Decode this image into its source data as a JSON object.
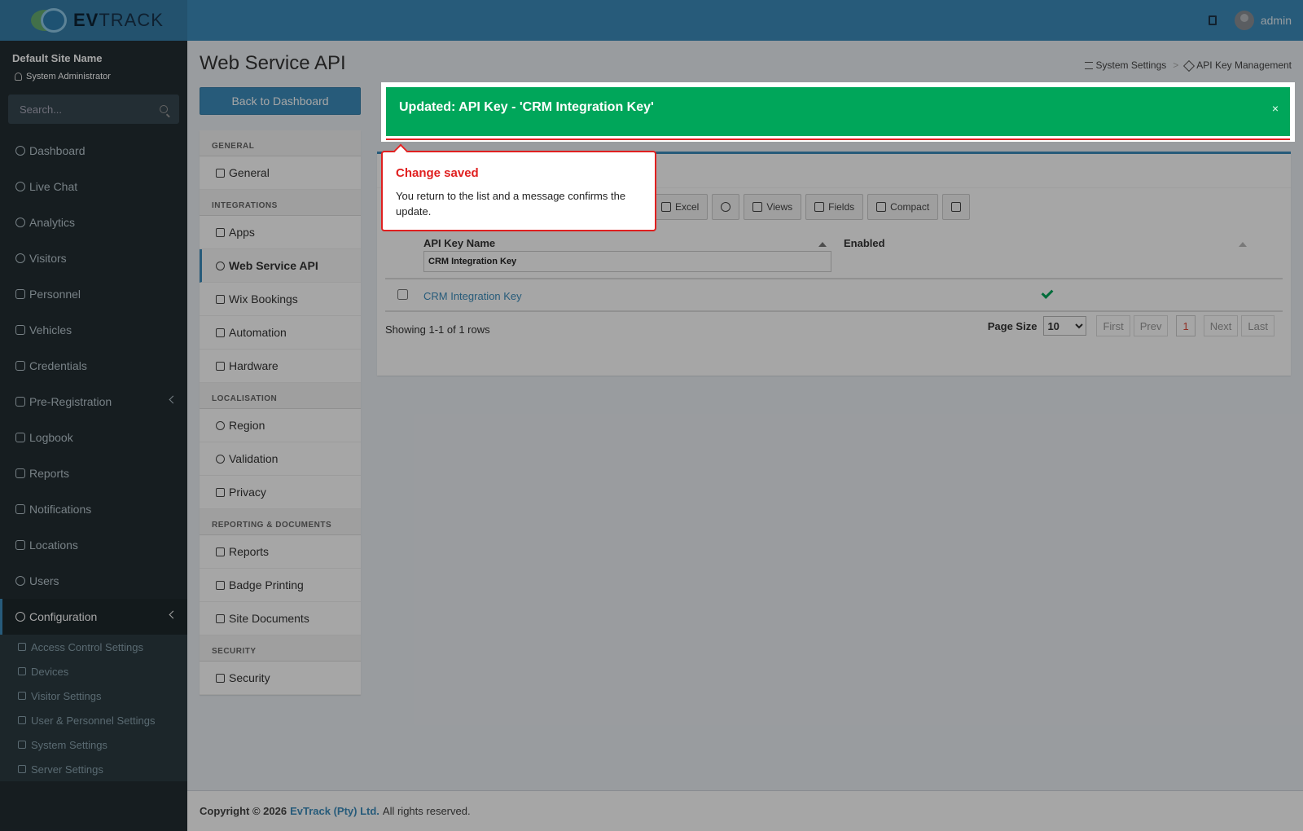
{
  "header": {
    "logo_left": "EV",
    "logo_right": "TRACK",
    "username": "admin"
  },
  "sidebar": {
    "site_name": "Default Site Name",
    "role": "System Administrator",
    "search_placeholder": "Search...",
    "items": [
      {
        "label": "Dashboard",
        "icon": "dashboard-icon"
      },
      {
        "label": "Live Chat",
        "icon": "headset-icon"
      },
      {
        "label": "Analytics",
        "icon": "analytics-icon"
      },
      {
        "label": "Visitors",
        "icon": "eye-icon"
      },
      {
        "label": "Personnel",
        "icon": "personnel-icon"
      },
      {
        "label": "Vehicles",
        "icon": "car-icon"
      },
      {
        "label": "Credentials",
        "icon": "id-card-icon"
      },
      {
        "label": "Pre-Registration",
        "icon": "arrows-icon"
      },
      {
        "label": "Logbook",
        "icon": "book-icon"
      },
      {
        "label": "Reports",
        "icon": "chart-icon"
      },
      {
        "label": "Notifications",
        "icon": "chat-icon"
      },
      {
        "label": "Locations",
        "icon": "map-icon"
      },
      {
        "label": "Users",
        "icon": "users-icon"
      },
      {
        "label": "Configuration",
        "icon": "gear-icon"
      }
    ],
    "sub_items": [
      {
        "label": "Access Control Settings",
        "icon": "lock-icon"
      },
      {
        "label": "Devices",
        "icon": "device-icon"
      },
      {
        "label": "Visitor Settings",
        "icon": "eye-icon"
      },
      {
        "label": "User & Personnel Settings",
        "icon": "users-icon"
      },
      {
        "label": "System Settings",
        "icon": "sliders-icon"
      },
      {
        "label": "Server Settings",
        "icon": "server-icon"
      }
    ]
  },
  "page": {
    "title": "Web Service API",
    "breadcrumb": [
      "System Settings",
      "API Key Management"
    ],
    "breadcrumb_sep": ">",
    "back_button": "Back to Dashboard"
  },
  "settings_menu": {
    "sections": [
      {
        "title": "GENERAL",
        "items": [
          "General"
        ]
      },
      {
        "title": "INTEGRATIONS",
        "items": [
          "Apps",
          "Web Service API",
          "Wix Bookings",
          "Automation",
          "Hardware"
        ]
      },
      {
        "title": "LOCALISATION",
        "items": [
          "Region",
          "Validation",
          "Privacy"
        ]
      },
      {
        "title": "REPORTING & DOCUMENTS",
        "items": [
          "Reports",
          "Badge Printing",
          "Site Documents"
        ]
      },
      {
        "title": "SECURITY",
        "items": [
          "Security"
        ]
      }
    ]
  },
  "toolbar": {
    "excel": "Excel",
    "views": "Views",
    "fields": "Fields",
    "compact": "Compact"
  },
  "grid": {
    "columns": [
      "API Key Name",
      "Enabled"
    ],
    "filter_value": "CRM Integration Key",
    "rows": [
      {
        "name": "CRM Integration Key",
        "enabled": true
      }
    ],
    "summary": "Showing 1-1 of 1 rows",
    "page_size_label": "Page Size",
    "page_size": "10",
    "pager": {
      "first": "First",
      "prev": "Prev",
      "current": "1",
      "next": "Next",
      "last": "Last"
    }
  },
  "alert": {
    "message": "Updated: API Key - 'CRM Integration Key'",
    "close": "×"
  },
  "tooltip": {
    "title": "Change saved",
    "body": "You return to the list and a message confirms the update."
  },
  "footer": {
    "prefix": "Copyright © 2026",
    "brand": "EvTrack (Pty) Ltd.",
    "suffix": "All rights reserved."
  },
  "colors": {
    "header": "#3c8dbc",
    "sidebar": "#222d32",
    "alert_success": "#00a65a",
    "highlight": "#e02020"
  }
}
